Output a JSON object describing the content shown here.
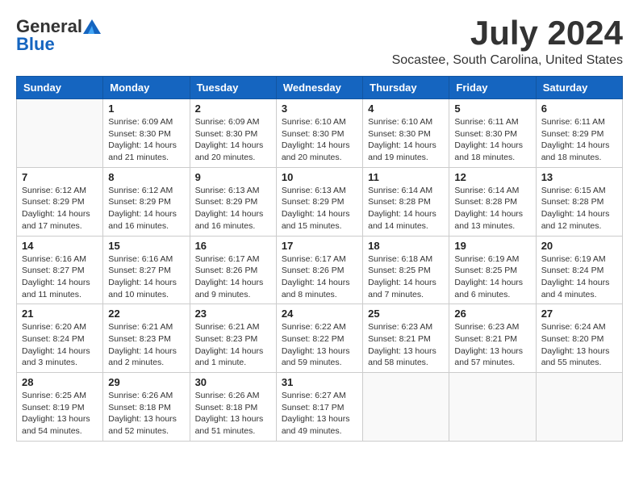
{
  "header": {
    "logo_general": "General",
    "logo_blue": "Blue",
    "month_year": "July 2024",
    "location": "Socastee, South Carolina, United States"
  },
  "weekdays": [
    "Sunday",
    "Monday",
    "Tuesday",
    "Wednesday",
    "Thursday",
    "Friday",
    "Saturday"
  ],
  "weeks": [
    [
      {
        "day": "",
        "info": ""
      },
      {
        "day": "1",
        "info": "Sunrise: 6:09 AM\nSunset: 8:30 PM\nDaylight: 14 hours\nand 21 minutes."
      },
      {
        "day": "2",
        "info": "Sunrise: 6:09 AM\nSunset: 8:30 PM\nDaylight: 14 hours\nand 20 minutes."
      },
      {
        "day": "3",
        "info": "Sunrise: 6:10 AM\nSunset: 8:30 PM\nDaylight: 14 hours\nand 20 minutes."
      },
      {
        "day": "4",
        "info": "Sunrise: 6:10 AM\nSunset: 8:30 PM\nDaylight: 14 hours\nand 19 minutes."
      },
      {
        "day": "5",
        "info": "Sunrise: 6:11 AM\nSunset: 8:30 PM\nDaylight: 14 hours\nand 18 minutes."
      },
      {
        "day": "6",
        "info": "Sunrise: 6:11 AM\nSunset: 8:29 PM\nDaylight: 14 hours\nand 18 minutes."
      }
    ],
    [
      {
        "day": "7",
        "info": "Sunrise: 6:12 AM\nSunset: 8:29 PM\nDaylight: 14 hours\nand 17 minutes."
      },
      {
        "day": "8",
        "info": "Sunrise: 6:12 AM\nSunset: 8:29 PM\nDaylight: 14 hours\nand 16 minutes."
      },
      {
        "day": "9",
        "info": "Sunrise: 6:13 AM\nSunset: 8:29 PM\nDaylight: 14 hours\nand 16 minutes."
      },
      {
        "day": "10",
        "info": "Sunrise: 6:13 AM\nSunset: 8:29 PM\nDaylight: 14 hours\nand 15 minutes."
      },
      {
        "day": "11",
        "info": "Sunrise: 6:14 AM\nSunset: 8:28 PM\nDaylight: 14 hours\nand 14 minutes."
      },
      {
        "day": "12",
        "info": "Sunrise: 6:14 AM\nSunset: 8:28 PM\nDaylight: 14 hours\nand 13 minutes."
      },
      {
        "day": "13",
        "info": "Sunrise: 6:15 AM\nSunset: 8:28 PM\nDaylight: 14 hours\nand 12 minutes."
      }
    ],
    [
      {
        "day": "14",
        "info": "Sunrise: 6:16 AM\nSunset: 8:27 PM\nDaylight: 14 hours\nand 11 minutes."
      },
      {
        "day": "15",
        "info": "Sunrise: 6:16 AM\nSunset: 8:27 PM\nDaylight: 14 hours\nand 10 minutes."
      },
      {
        "day": "16",
        "info": "Sunrise: 6:17 AM\nSunset: 8:26 PM\nDaylight: 14 hours\nand 9 minutes."
      },
      {
        "day": "17",
        "info": "Sunrise: 6:17 AM\nSunset: 8:26 PM\nDaylight: 14 hours\nand 8 minutes."
      },
      {
        "day": "18",
        "info": "Sunrise: 6:18 AM\nSunset: 8:25 PM\nDaylight: 14 hours\nand 7 minutes."
      },
      {
        "day": "19",
        "info": "Sunrise: 6:19 AM\nSunset: 8:25 PM\nDaylight: 14 hours\nand 6 minutes."
      },
      {
        "day": "20",
        "info": "Sunrise: 6:19 AM\nSunset: 8:24 PM\nDaylight: 14 hours\nand 4 minutes."
      }
    ],
    [
      {
        "day": "21",
        "info": "Sunrise: 6:20 AM\nSunset: 8:24 PM\nDaylight: 14 hours\nand 3 minutes."
      },
      {
        "day": "22",
        "info": "Sunrise: 6:21 AM\nSunset: 8:23 PM\nDaylight: 14 hours\nand 2 minutes."
      },
      {
        "day": "23",
        "info": "Sunrise: 6:21 AM\nSunset: 8:23 PM\nDaylight: 14 hours\nand 1 minute."
      },
      {
        "day": "24",
        "info": "Sunrise: 6:22 AM\nSunset: 8:22 PM\nDaylight: 13 hours\nand 59 minutes."
      },
      {
        "day": "25",
        "info": "Sunrise: 6:23 AM\nSunset: 8:21 PM\nDaylight: 13 hours\nand 58 minutes."
      },
      {
        "day": "26",
        "info": "Sunrise: 6:23 AM\nSunset: 8:21 PM\nDaylight: 13 hours\nand 57 minutes."
      },
      {
        "day": "27",
        "info": "Sunrise: 6:24 AM\nSunset: 8:20 PM\nDaylight: 13 hours\nand 55 minutes."
      }
    ],
    [
      {
        "day": "28",
        "info": "Sunrise: 6:25 AM\nSunset: 8:19 PM\nDaylight: 13 hours\nand 54 minutes."
      },
      {
        "day": "29",
        "info": "Sunrise: 6:26 AM\nSunset: 8:18 PM\nDaylight: 13 hours\nand 52 minutes."
      },
      {
        "day": "30",
        "info": "Sunrise: 6:26 AM\nSunset: 8:18 PM\nDaylight: 13 hours\nand 51 minutes."
      },
      {
        "day": "31",
        "info": "Sunrise: 6:27 AM\nSunset: 8:17 PM\nDaylight: 13 hours\nand 49 minutes."
      },
      {
        "day": "",
        "info": ""
      },
      {
        "day": "",
        "info": ""
      },
      {
        "day": "",
        "info": ""
      }
    ]
  ]
}
